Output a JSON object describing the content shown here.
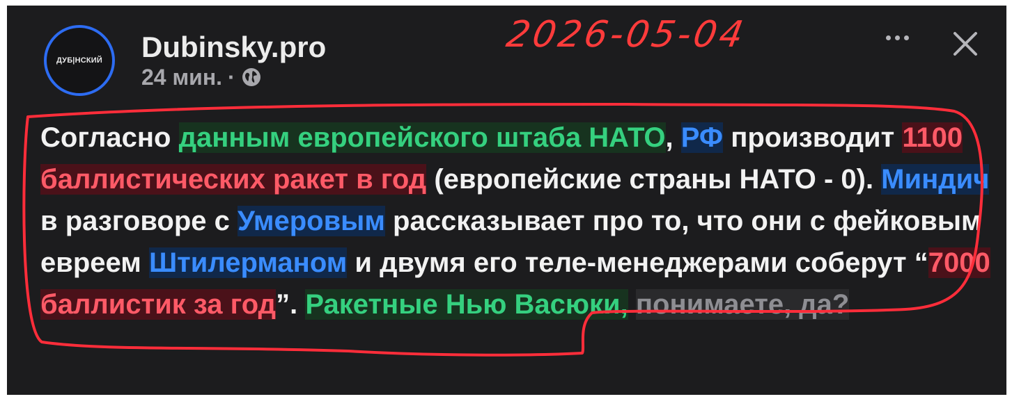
{
  "post": {
    "author": "Dubinsky.pro",
    "avatar_label": "ДУБ|НСКИЙ",
    "time": "24 мин.",
    "separator": "·",
    "visibility_icon": "globe-icon",
    "menu_icon": "more-icon",
    "close_icon": "close-icon"
  },
  "annotation": {
    "date": "2026-05-04",
    "color": "#ff2d3a"
  },
  "colors": {
    "background": "#1c1c1e",
    "text": "#f2f2f2",
    "highlight_green": "#35d07f",
    "highlight_blue": "#3a8cff",
    "highlight_red": "#ff5a67",
    "avatar_ring": "#2d6cf2"
  },
  "content": {
    "s1": "Согласно ",
    "s2": "данным европейского штаба НАТО",
    "s3": ", ",
    "s4": "РФ",
    "s5": " производит ",
    "s6": "1100 баллистических ракет в год",
    "s7": " (европейские страны НАТО - 0). ",
    "s8": "Миндич",
    "s9": " в разговоре с ",
    "s10": "Умеровым",
    "s11": " рассказывает про то, что они с фейковым евреем ",
    "s12": "Штилерманом",
    "s13": " и двумя его теле-менеджерами соберут “",
    "s14": "7000 баллистик за год",
    "s15": "”. ",
    "s16": "Ракетные Нью Васюки,",
    "s17": " ",
    "s18": "понимаете, да?"
  }
}
